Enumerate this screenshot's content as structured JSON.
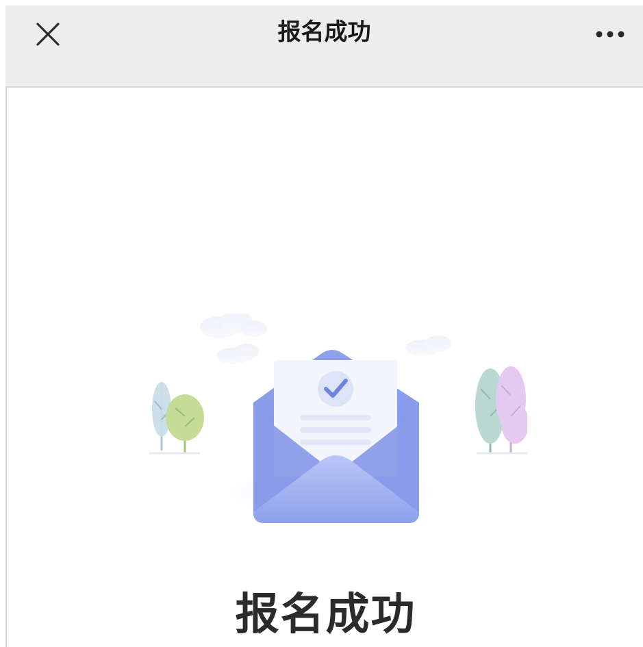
{
  "nav": {
    "title": "报名成功",
    "close_icon": "close-icon",
    "more_icon": "more-icon"
  },
  "main": {
    "illustration": "envelope-check-illustration",
    "success_title": "报名成功"
  },
  "colors": {
    "nav_bg": "#ededed",
    "envelope": "#7f93e6",
    "check": "#6d85df",
    "title_text": "#2b2b2b"
  }
}
